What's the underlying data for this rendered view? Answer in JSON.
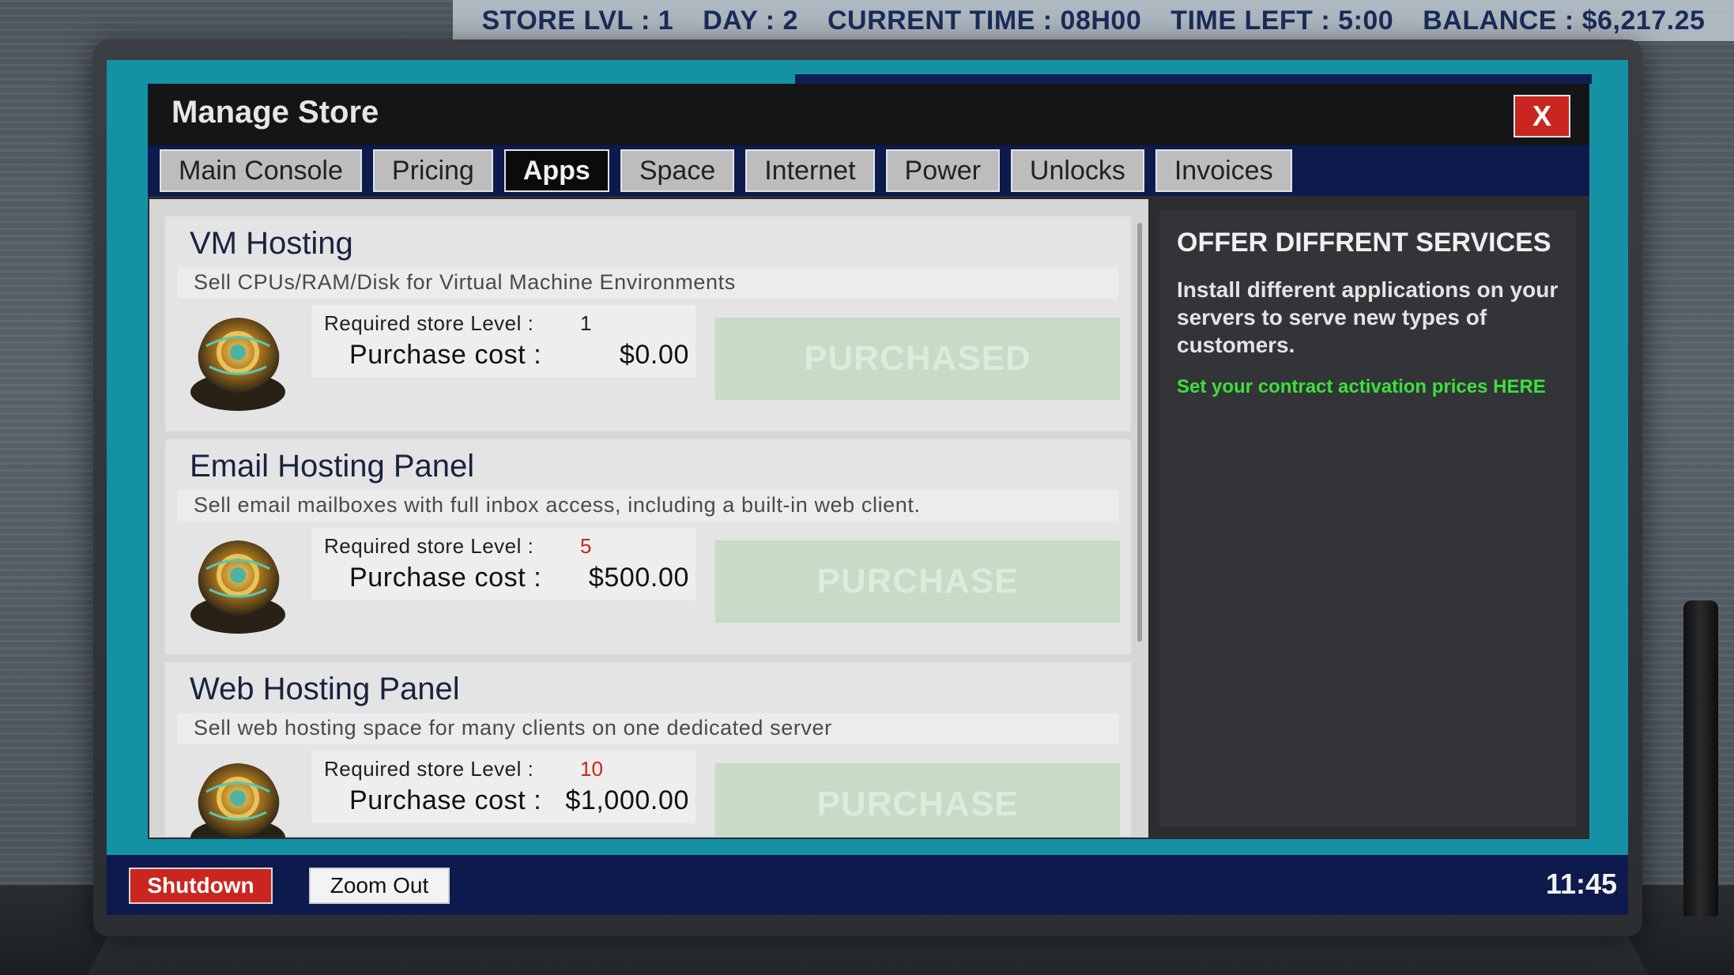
{
  "hud": {
    "store_lvl": "STORE LVL : 1",
    "day": "DAY : 2",
    "current_time": "CURRENT TIME : 08H00",
    "time_left": "TIME LEFT : 5:00",
    "balance": "BALANCE : $6,217.25"
  },
  "window": {
    "title": "Manage Store",
    "close_label": "X"
  },
  "tabs": [
    {
      "label": "Main Console",
      "active": false
    },
    {
      "label": "Pricing",
      "active": false
    },
    {
      "label": "Apps",
      "active": true
    },
    {
      "label": "Space",
      "active": false
    },
    {
      "label": "Internet",
      "active": false
    },
    {
      "label": "Power",
      "active": false
    },
    {
      "label": "Unlocks",
      "active": false
    },
    {
      "label": "Invoices",
      "active": false
    }
  ],
  "apps": [
    {
      "name": "VM Hosting",
      "description": "Sell CPUs/RAM/Disk for Virtual Machine Environments",
      "req_label": "Required store Level :",
      "req_level": "1",
      "req_locked": false,
      "cost_label": "Purchase cost :",
      "cost": "$0.00",
      "button": "PURCHASED"
    },
    {
      "name": "Email Hosting Panel",
      "description": "Sell email mailboxes with full inbox access, including a built-in web client.",
      "req_label": "Required store Level :",
      "req_level": "5",
      "req_locked": true,
      "cost_label": "Purchase cost :",
      "cost": "$500.00",
      "button": "PURCHASE"
    },
    {
      "name": "Web Hosting Panel",
      "description": "Sell web hosting space for many clients on one dedicated server",
      "req_label": "Required store Level :",
      "req_level": "10",
      "req_locked": true,
      "cost_label": "Purchase cost :",
      "cost": "$1,000.00",
      "button": "PURCHASE"
    }
  ],
  "info_panel": {
    "title": "OFFER DIFFRENT SERVICES",
    "text": "Install different applications on your servers to serve new types of customers.",
    "link": "Set your contract activation prices HERE"
  },
  "taskbar": {
    "shutdown_label": "Shutdown",
    "zoom_label": "Zoom Out",
    "clock": "11:45"
  },
  "colors": {
    "screen_bg": "#1591a6",
    "navy": "#0d1a4d",
    "danger": "#c9261f",
    "link_green": "#3ce03c",
    "locked_red": "#d1201b"
  },
  "icons": [
    "close-icon",
    "app-icon-gear"
  ]
}
